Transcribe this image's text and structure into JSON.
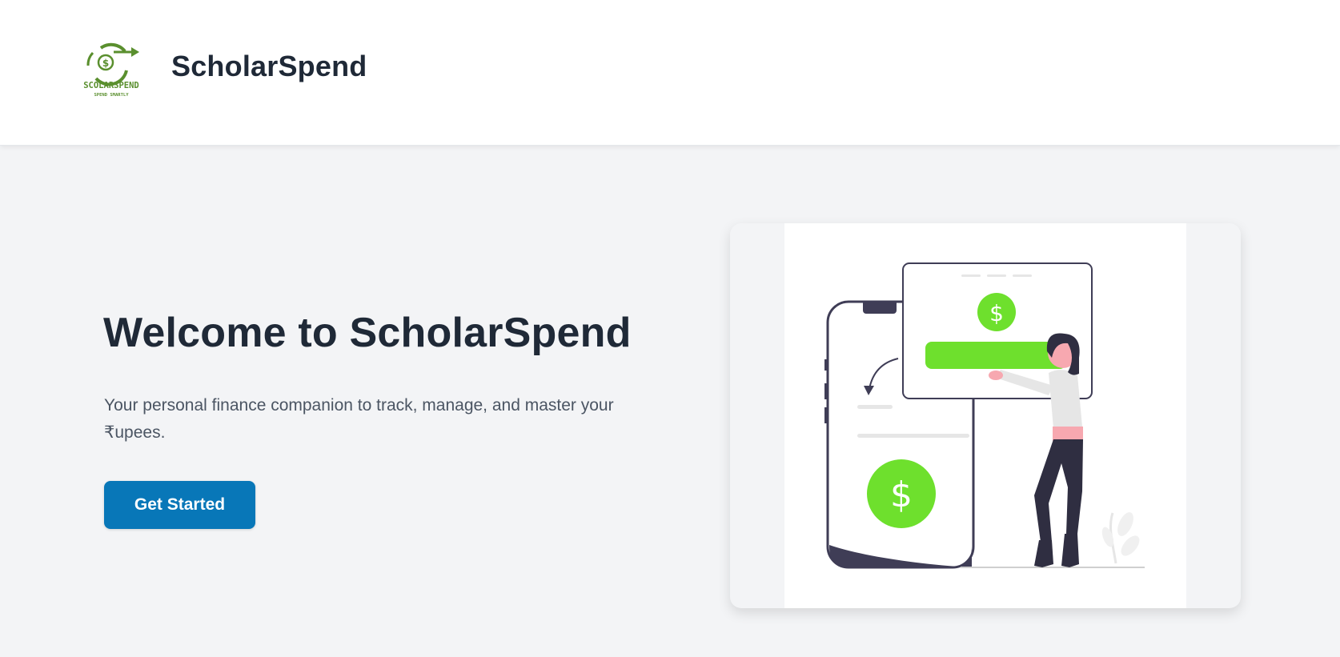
{
  "header": {
    "app_name": "ScholarSpend",
    "logo": {
      "icon": "circular-arrows-dollar-logo",
      "text": "SCOLARSPEND",
      "tagline": "SPEND SMARTLY",
      "color": "#5a8f2e"
    }
  },
  "hero": {
    "title": "Welcome to ScholarSpend",
    "subtitle": "Your personal finance companion to track, manage, and master your ₹upees.",
    "cta_label": "Get Started"
  },
  "illustration": {
    "icon": "woman-with-phone-and-payment-card-illustration",
    "accent_color": "#6ee02d",
    "dark_color": "#3f3d56",
    "symbol": "$"
  },
  "colors": {
    "background": "#f3f4f6",
    "header_bg": "#ffffff",
    "primary_button": "#0877b8",
    "heading_text": "#1f2937",
    "body_text": "#4b5563"
  }
}
